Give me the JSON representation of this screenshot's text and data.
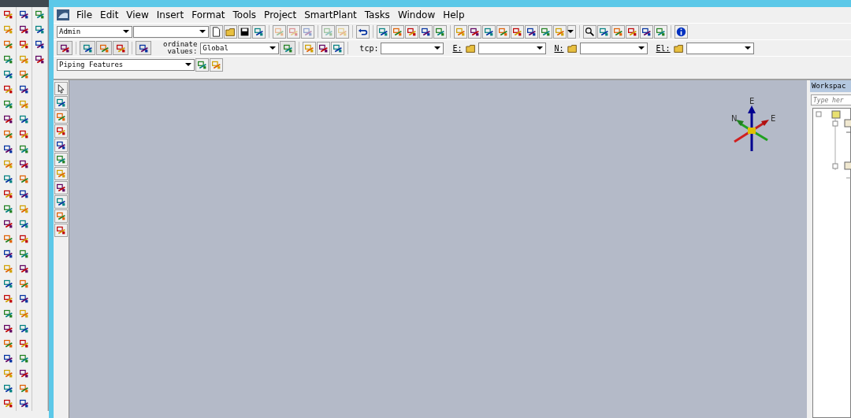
{
  "menu": [
    {
      "label": "File"
    },
    {
      "label": "Edit"
    },
    {
      "label": "View"
    },
    {
      "label": "Insert"
    },
    {
      "label": "Format"
    },
    {
      "label": "Tools"
    },
    {
      "label": "Project"
    },
    {
      "label": "SmartPlant"
    },
    {
      "label": "Tasks"
    },
    {
      "label": "Window"
    },
    {
      "label": "Help"
    }
  ],
  "toolbar_1": {
    "task_combo": {
      "value": "Admin"
    }
  },
  "toolbar_2": {
    "coordinate_label": [
      "ordinate",
      "values:"
    ],
    "coordinate_combo": {
      "value": "Global"
    },
    "tcp_label": "tcp:",
    "e_label": "E:",
    "n_label": "N:",
    "el_label": "El:"
  },
  "toolbar_3": {
    "features_combo": {
      "value": "Piping Features"
    }
  },
  "compass": {
    "labels": [
      "E",
      "N",
      "E"
    ]
  },
  "workspace_panel": {
    "title": "Workspac",
    "search": {
      "placeholder": "Type her"
    }
  }
}
